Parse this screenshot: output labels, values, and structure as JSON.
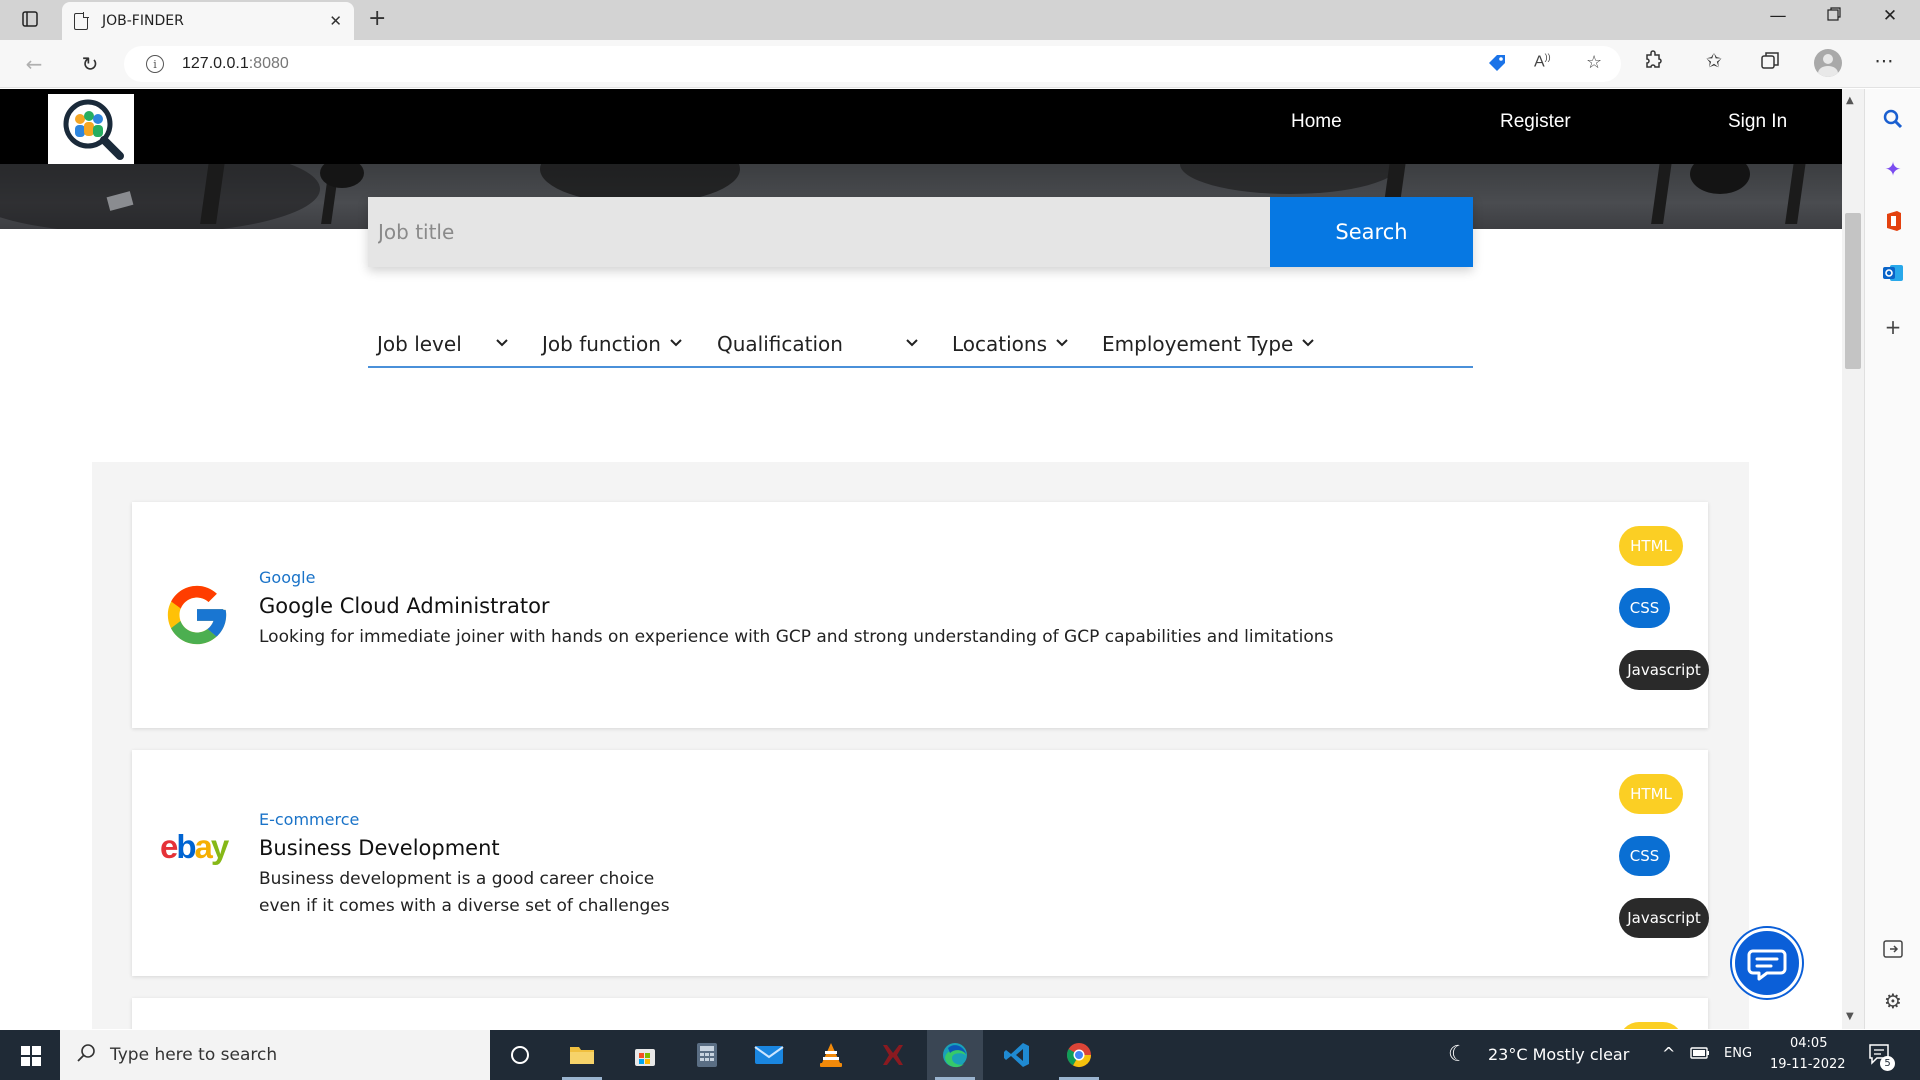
{
  "browser": {
    "tab_title": "JOB-FINDER",
    "tab_close": "✕",
    "new_tab": "+",
    "url_host": "127.0.0.1",
    "url_port": ":8080"
  },
  "navbar": {
    "links": [
      "Home",
      "Register",
      "Sign In"
    ]
  },
  "search": {
    "placeholder": "Job title",
    "button_label": "Search"
  },
  "filters": [
    "Job level",
    "Job function",
    "Qualification",
    "Locations",
    "Employement Type"
  ],
  "jobs": [
    {
      "company": "Google",
      "title": "Google Cloud Administrator",
      "description": [
        "Looking for immediate joiner with hands on experience with GCP and strong understanding of GCP capabilities and limitations"
      ],
      "tags": [
        "HTML",
        "CSS",
        "Javascript"
      ]
    },
    {
      "company": "E-commerce",
      "title": "Business Development",
      "description": [
        "Business development is a good career choice",
        "even if it comes with a diverse set of challenges"
      ],
      "tags": [
        "HTML",
        "CSS",
        "Javascript"
      ]
    }
  ],
  "taskbar": {
    "search_placeholder": "Type here to search",
    "weather": "23°C  Mostly clear",
    "language": "ENG",
    "time": "04:05",
    "date": "19-11-2022",
    "notification_count": "5"
  },
  "colors": {
    "accent": "#0678e3",
    "navbar": "#000000",
    "tag_html": "#fbcf24",
    "tag_css": "#0a6fd3",
    "tag_js": "#2a2a2a",
    "company_link": "#1a73c8"
  }
}
